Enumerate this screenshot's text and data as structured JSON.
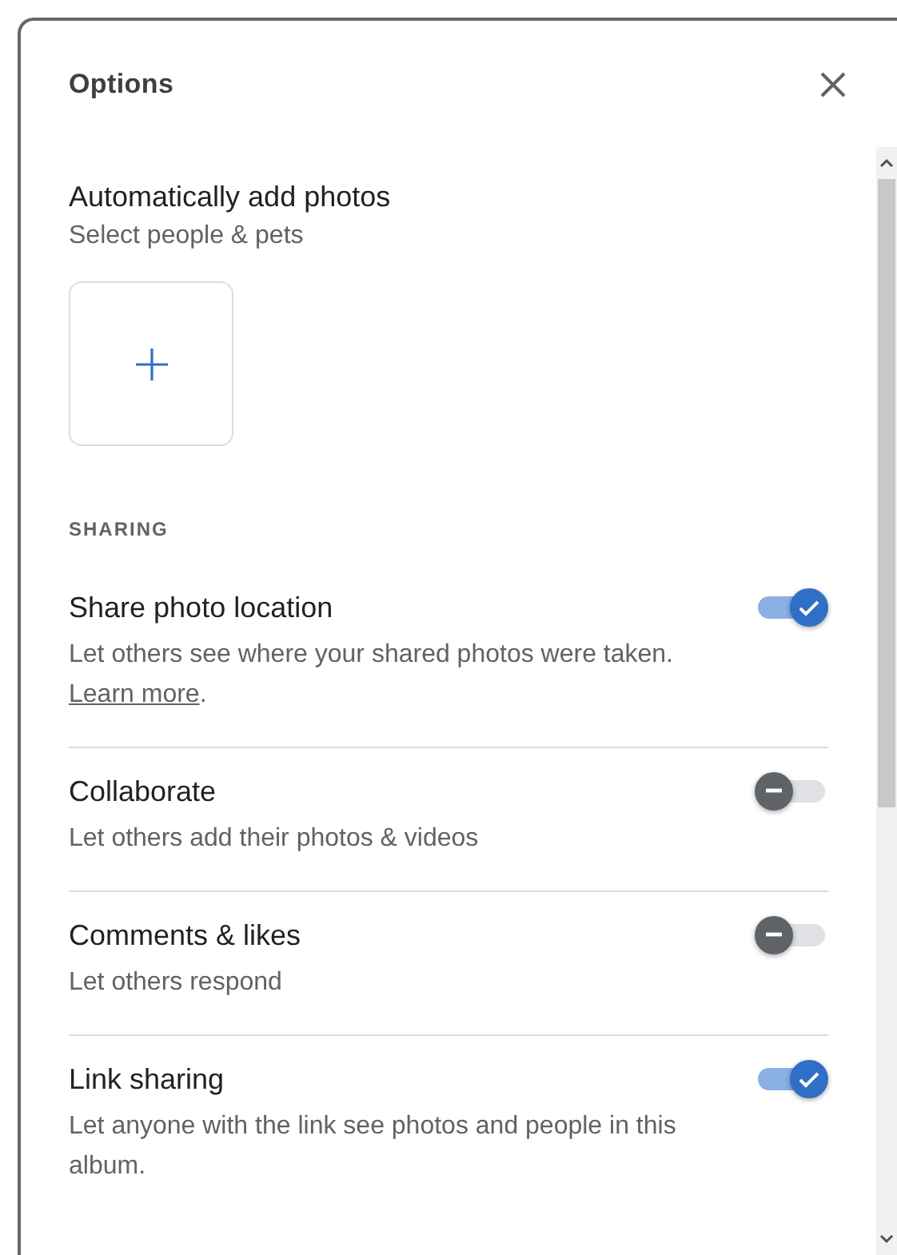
{
  "dialog": {
    "title": "Options"
  },
  "auto_add": {
    "title": "Automatically add photos",
    "subtitle": "Select people & pets"
  },
  "sharing": {
    "heading": "SHARING",
    "settings": [
      {
        "title": "Share photo location",
        "description": "Let others see where your shared photos were taken.",
        "link": "Learn more",
        "link_suffix": ".",
        "on": true
      },
      {
        "title": "Collaborate",
        "description": "Let others add their photos & videos",
        "on": false
      },
      {
        "title": "Comments & likes",
        "description": "Let others respond",
        "on": false
      },
      {
        "title": "Link sharing",
        "description": "Let anyone with the link see photos and people in this album.",
        "on": true
      }
    ]
  }
}
